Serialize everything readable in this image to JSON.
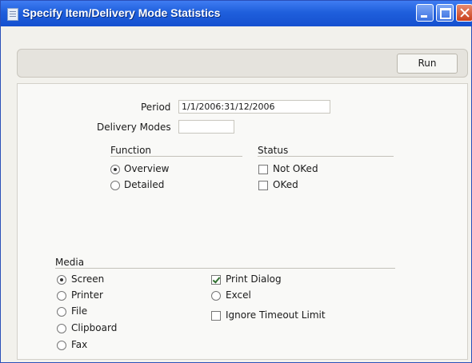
{
  "window": {
    "title": "Specify Item/Delivery Mode Statistics"
  },
  "toolbar": {
    "run_label": "Run"
  },
  "form": {
    "period_label": "Period",
    "period_value": "1/1/2006:31/12/2006",
    "delivery_modes_label": "Delivery Modes",
    "delivery_modes_value": ""
  },
  "function_group": {
    "title": "Function",
    "options": [
      {
        "label": "Overview",
        "selected": true
      },
      {
        "label": "Detailed",
        "selected": false
      }
    ]
  },
  "status_group": {
    "title": "Status",
    "options": [
      {
        "label": "Not OKed",
        "checked": false
      },
      {
        "label": "OKed",
        "checked": false
      }
    ]
  },
  "media_group": {
    "title": "Media",
    "options": [
      {
        "label": "Screen",
        "selected": true
      },
      {
        "label": "Printer",
        "selected": false
      },
      {
        "label": "File",
        "selected": false
      },
      {
        "label": "Clipboard",
        "selected": false
      },
      {
        "label": "Fax",
        "selected": false
      }
    ],
    "print_dialog": {
      "label": "Print Dialog",
      "checked": true
    },
    "excel": {
      "label": "Excel",
      "selected": false
    },
    "ignore_timeout": {
      "label": "Ignore Timeout Limit",
      "checked": false
    }
  }
}
